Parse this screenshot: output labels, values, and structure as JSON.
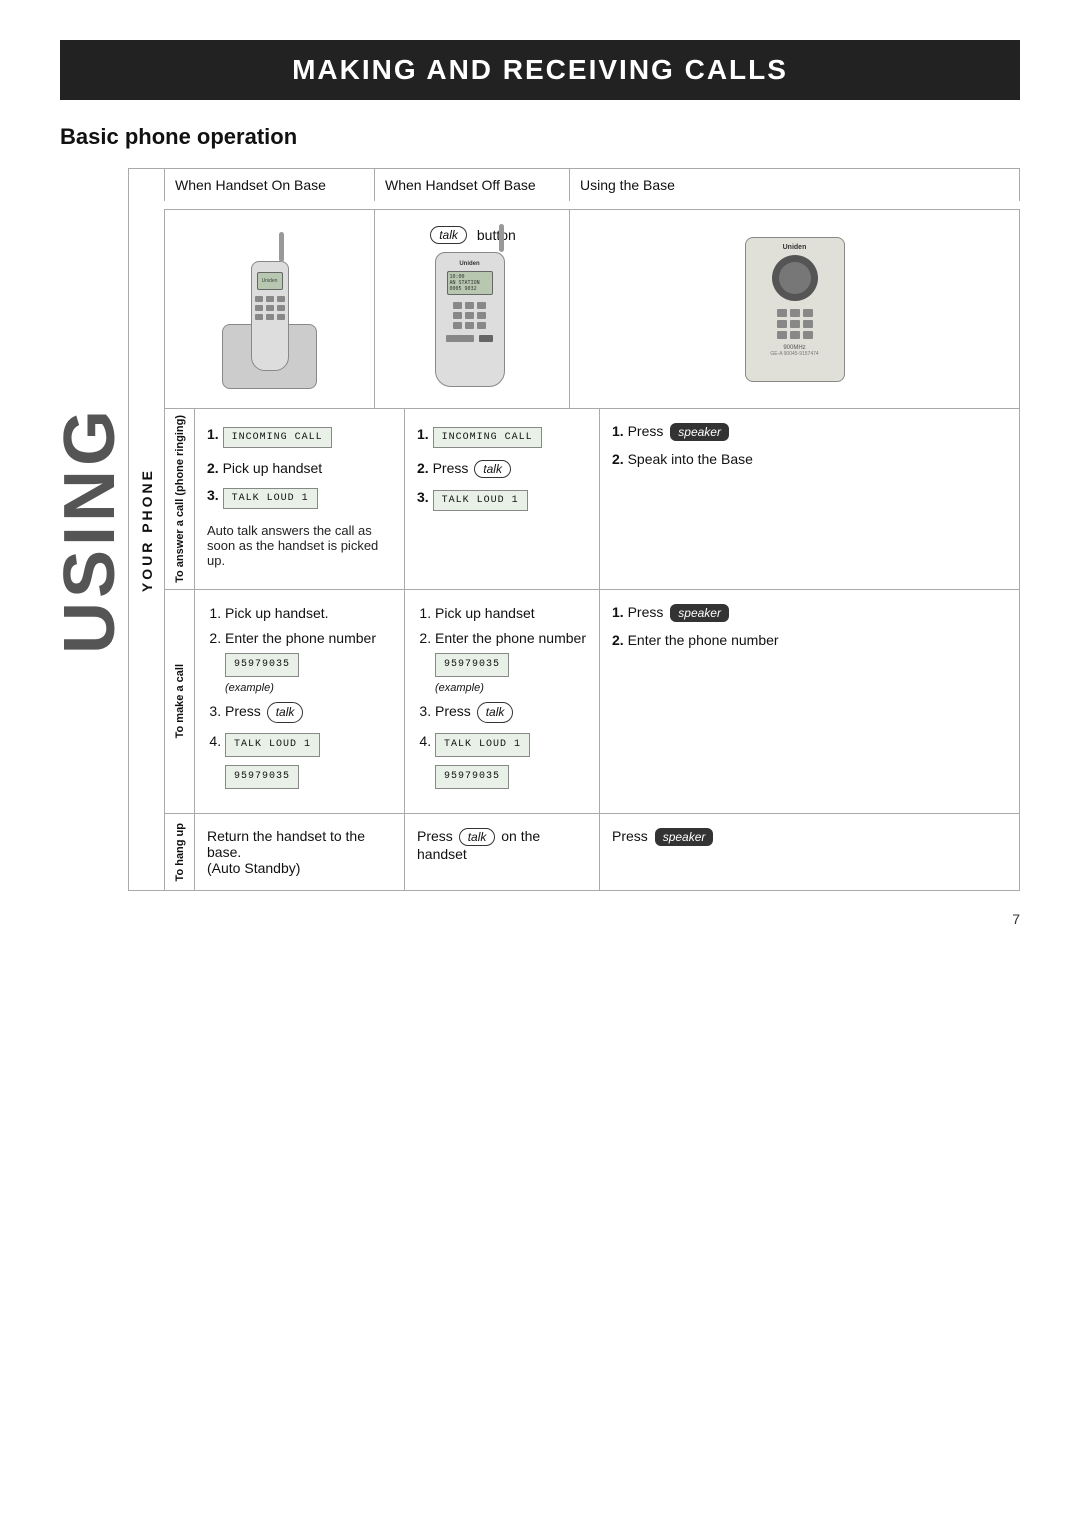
{
  "page": {
    "title": "MAKING AND RECEIVING CALLS",
    "section_title": "Basic phone operation",
    "page_number": "7"
  },
  "column_headers": {
    "col1": "When Handset On Base",
    "col2": "When Handset Off Base",
    "col3": "Using the Base"
  },
  "talk_button_label": "talk",
  "button_label": "button",
  "rows": {
    "answer_call": {
      "side_label": "To answer a call (phone ringing)",
      "col1": {
        "step1_lcd": "INCOMING CALL",
        "step2": "Pick up handset",
        "step3_lcd": "TALK  LOUD  1",
        "note": "Auto talk answers the call as soon as the handset is picked up."
      },
      "col2": {
        "step1_lcd": "INCOMING CALL",
        "step2_press": "Press",
        "step2_talk": "talk",
        "step3_lcd": "TALK  LOUD  1"
      },
      "col3": {
        "step1_press": "Press",
        "step1_badge": "speaker",
        "step2": "Speak into the Base"
      }
    },
    "make_call": {
      "side_label": "To make a call",
      "col1": {
        "step1": "Pick up handset.",
        "step2": "Enter the phone number",
        "step2_lcd": "95979035",
        "step2_lcd_sub": "(example)",
        "step3_press": "Press",
        "step3_talk": "talk",
        "step4_lcd": "TALK  LOUD  1",
        "step4_lcd2": "95979035"
      },
      "col2": {
        "step1": "Pick up handset",
        "step2": "Enter the phone number",
        "step2_lcd": "95979035",
        "step2_lcd_sub": "(example)",
        "step3_press": "Press",
        "step3_talk": "talk",
        "step4_lcd": "TALK  LOUD  1",
        "step4_lcd2": "95979035"
      },
      "col3": {
        "step1_press": "Press",
        "step1_badge": "speaker",
        "step2": "Enter the phone number"
      }
    },
    "hang_up": {
      "side_label": "To hang up",
      "col1": {
        "text1": "Return the handset to the base.",
        "text2": "(Auto Standby)"
      },
      "col2": {
        "text1": "Press",
        "talk": "talk",
        "text2": "on the handset"
      },
      "col3": {
        "text1": "Press",
        "badge": "speaker"
      }
    }
  },
  "side_labels": {
    "using": "USING",
    "your_phone": "YOUR PHONE"
  }
}
